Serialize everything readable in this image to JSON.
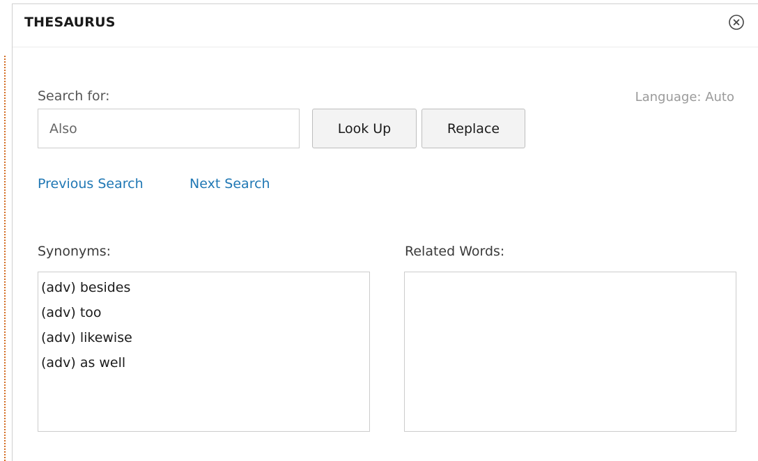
{
  "dialog": {
    "title": "THESAURUS",
    "close_icon": "close-circle-icon"
  },
  "search": {
    "label": "Search for:",
    "value": "Also",
    "language": "Language: Auto",
    "lookup_label": "Look Up",
    "replace_label": "Replace"
  },
  "navigation": {
    "previous_label": "Previous Search",
    "next_label": "Next Search"
  },
  "synonyms": {
    "label": "Synonyms:",
    "items": [
      "(adv) besides",
      "(adv) too",
      "(adv) likewise",
      "(adv) as well"
    ]
  },
  "related": {
    "label": "Related Words:",
    "items": []
  },
  "colors": {
    "link": "#1f77b4",
    "button_bg": "#f3f3f3",
    "border": "#cccccc",
    "left_edge_dots": "#d2691e"
  }
}
